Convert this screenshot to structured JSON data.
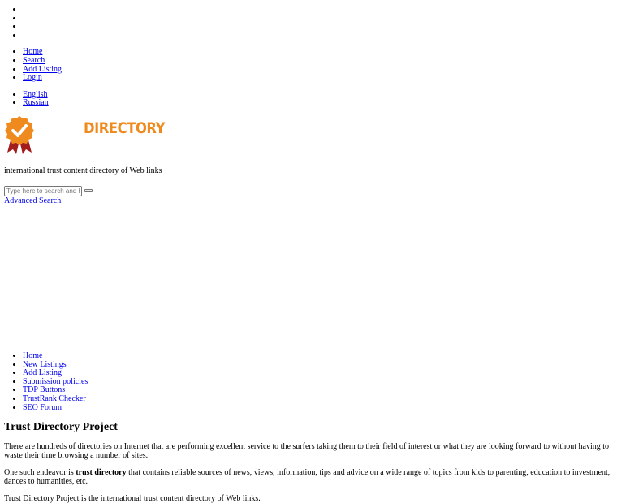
{
  "top_nav": {
    "items": [
      "Home",
      "Search",
      "Add Listing",
      "Login"
    ]
  },
  "languages": [
    "English",
    "Russian"
  ],
  "logo": {
    "text": "DIRECTORY",
    "accent": "#ef8a1e",
    "ribbon": "#a31d1d"
  },
  "tagline": "international trust content directory of Web links",
  "search": {
    "placeholder": "Type here to search and hit enter",
    "advanced_label": "Advanced Search"
  },
  "main_nav": {
    "items": [
      "Home",
      "New Listings",
      "Add Listing",
      "Submission policies",
      "TDP Buttons",
      "TrustRank Checker",
      "SEO Forum"
    ]
  },
  "article": {
    "title": "Trust Directory Project",
    "para1": "There are hundreds of directories on Internet that are performing excellent service to the surfers taking them to their field of interest or what they are looking forward to without having to waste their time browsing a number of sites.",
    "para2_prefix": "One such endeavor is ",
    "para2_bold": "trust directory",
    "para2_suffix": " that contains reliable sources of news, views, information, tips and advice on a wide range of topics from kids to parenting, education to investment, dances to humanities, etc.",
    "para3": "Trust Directory Project is the international trust content directory of Web links."
  }
}
